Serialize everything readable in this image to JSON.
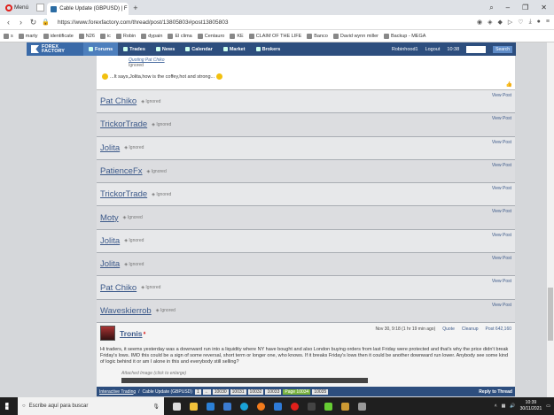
{
  "browser": {
    "menu_label": "Menú",
    "tab_title": "Cable Update (GBPUSD) | F",
    "url": "https://www.forexfactory.com/thread/post/13805803#post13805803"
  },
  "bookmarks": [
    "s",
    "marty",
    "identificate",
    "N26",
    "ic",
    "Robin",
    "dypain",
    "El clima",
    "Centauro",
    "KE",
    "CLAIM OF THE LIFE",
    "Banco",
    "David wynn miller",
    "Backup - MEGA"
  ],
  "forum": {
    "logo_line1": "FOREX",
    "logo_line2": "FACTORY",
    "nav": [
      "Forums",
      "Trades",
      "News",
      "Calendar",
      "Market",
      "Brokers"
    ],
    "user": "Robinhood1",
    "logout": "Logout",
    "time": "10:38",
    "search_label": "Search"
  },
  "quote_post": {
    "quoting": "Quoting Pat Chiko",
    "ignored": "Ignored",
    "text": "...It says,Jolita,how is the coffey,hot and strong..."
  },
  "ignored_label": "Ignored",
  "view_post_label": "View Post",
  "posts": [
    {
      "user": "Pat Chiko"
    },
    {
      "user": "TrickorTrade"
    },
    {
      "user": "Jolita"
    },
    {
      "user": "PatienceFx"
    },
    {
      "user": "TrickorTrade"
    },
    {
      "user": "Moty"
    },
    {
      "user": "Jolita"
    },
    {
      "user": "Jolita"
    },
    {
      "user": "Pat Chiko"
    },
    {
      "user": "Waveskierrob"
    }
  ],
  "tronis": {
    "user": "Tronis",
    "date": "Nov 30, 9:18 (1 hr 19 min ago)",
    "quote": "Quote",
    "cleanup": "Cleanup",
    "post_num": "Post 642,160",
    "body": "Hi traders, it seems yesterday was a downward run into a liquidity where NY have bought and also London buying orders from last Friday were protected and that's why the price didn't break Friday's lows. IMO this could be a sign of some reversal, short term or longer one, who knows. If it breaks Friday's lows then it could be another downward run lower. Anybody see some kind of logic behind it or am I alone in this and everybody still selling?",
    "attached": "Attached Image (click to enlarge)"
  },
  "bottom_bar": {
    "crumb1": "Interactive Trading",
    "crumb2": "Cable Update (GBPUSD)",
    "pages": [
      "1",
      "←",
      "10030",
      "10031",
      "10032",
      "10033",
      "Page 10034",
      "10035"
    ],
    "reply": "Reply to Thread"
  },
  "taskbar": {
    "search_placeholder": "Escribe aquí para buscar",
    "time": "10:39",
    "date": "30/11/2021"
  }
}
